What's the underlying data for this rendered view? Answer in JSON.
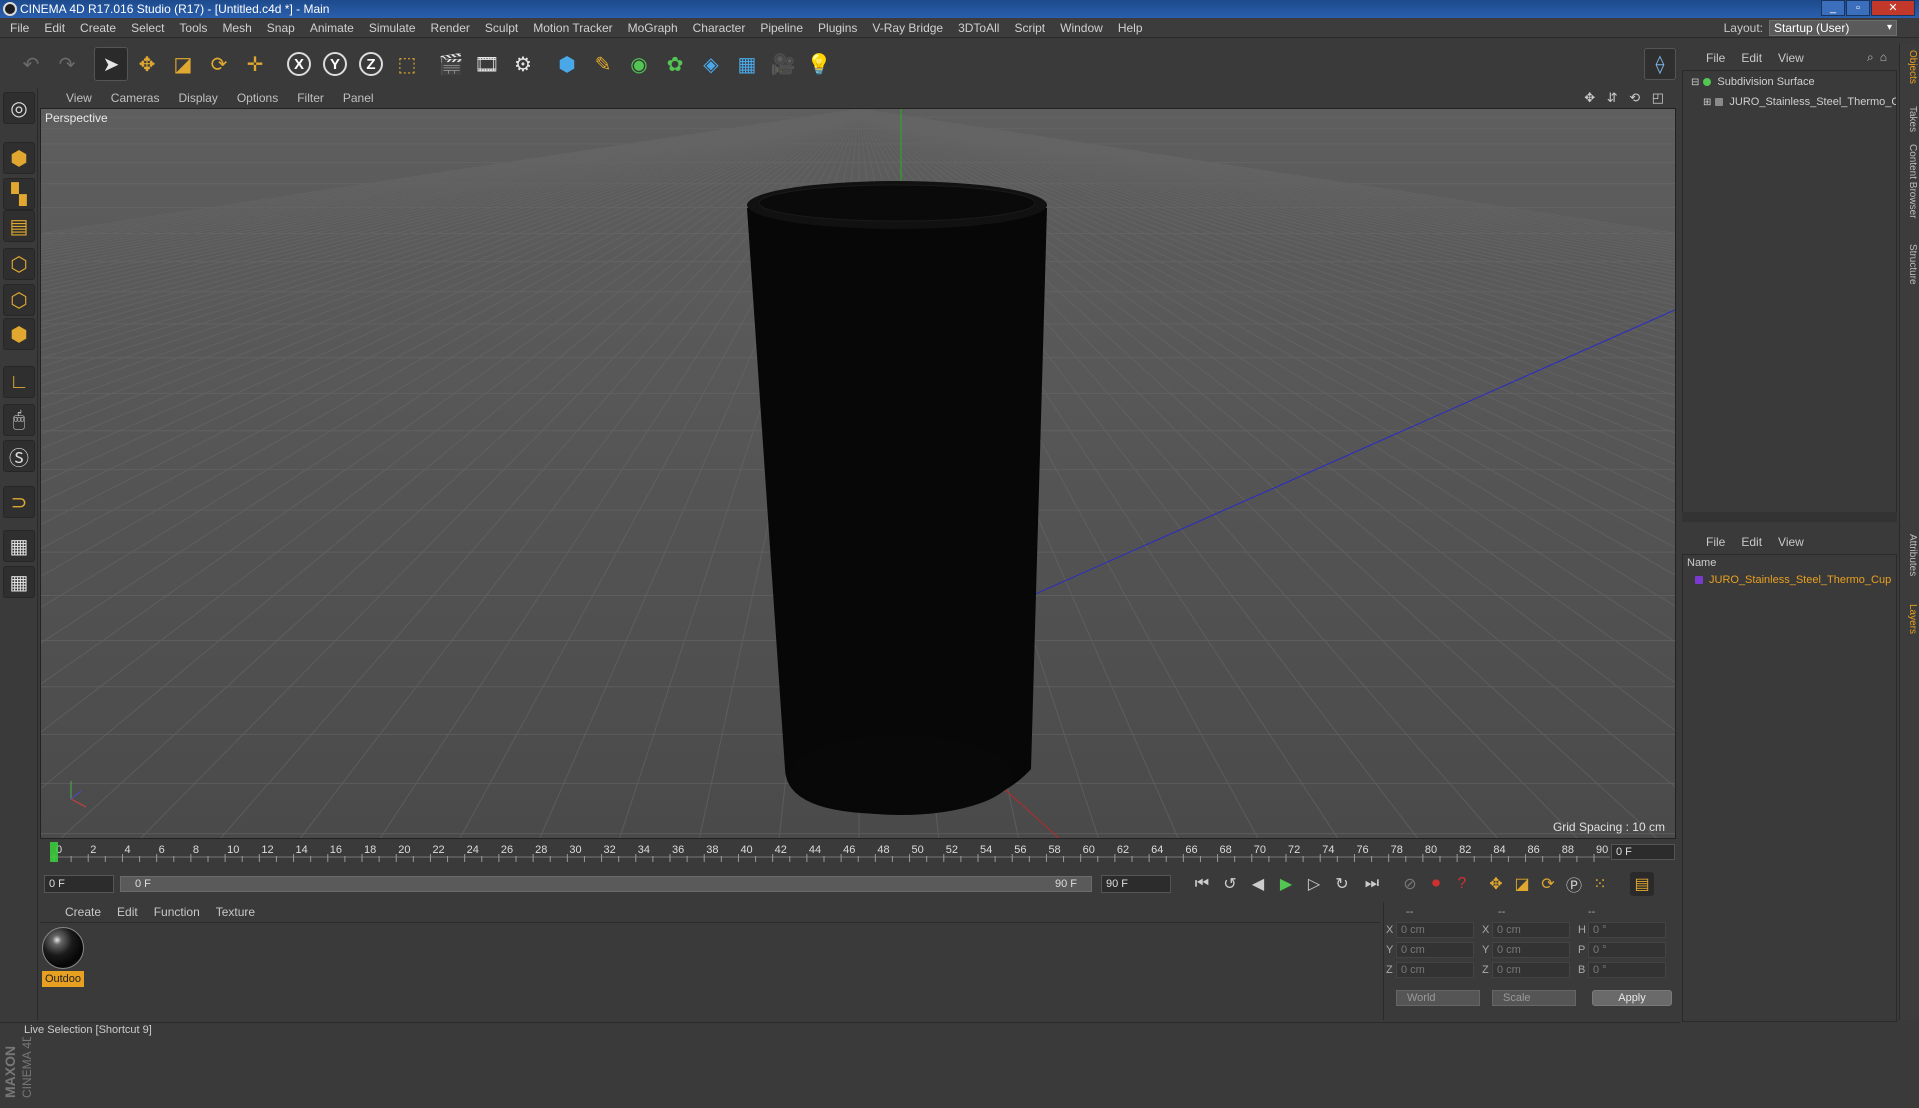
{
  "window": {
    "title": "CINEMA 4D R17.016 Studio (R17) - [Untitled.c4d *] - Main",
    "buttons": [
      "_",
      "▫",
      "✕"
    ]
  },
  "menubar": {
    "items": [
      "File",
      "Edit",
      "Create",
      "Select",
      "Tools",
      "Mesh",
      "Snap",
      "Animate",
      "Simulate",
      "Render",
      "Sculpt",
      "Motion Tracker",
      "MoGraph",
      "Character",
      "Pipeline",
      "Plugins",
      "V-Ray Bridge",
      "3DToAll",
      "Script",
      "Window",
      "Help"
    ],
    "layout_label": "Layout:",
    "layout_value": "Startup (User)"
  },
  "toolbar": {
    "icons": [
      "undo-icon",
      "redo-icon",
      "live-selection-icon",
      "move-icon",
      "scale-icon",
      "rotate-icon",
      "add-object-icon",
      "x-axis-icon",
      "y-axis-icon",
      "z-axis-icon",
      "world-coordinates-icon",
      "render-view-icon",
      "render-picture-viewer-icon",
      "edit-render-settings-icon",
      "cube-icon",
      "pen-icon",
      "subdivision-icon",
      "cloner-icon",
      "deformer-icon",
      "floor-icon",
      "camera-icon",
      "light-icon"
    ],
    "axis_labels": [
      "X",
      "Y",
      "Z"
    ]
  },
  "viewport": {
    "menu": [
      "View",
      "Cameras",
      "Display",
      "Options",
      "Filter",
      "Panel"
    ],
    "label": "Perspective",
    "grid_spacing": "Grid Spacing : 10 cm",
    "nav_icons": "✥ ⇵ ⟲ ◰"
  },
  "timeline": {
    "ticks": [
      "0",
      "2",
      "4",
      "6",
      "8",
      "10",
      "12",
      "14",
      "16",
      "18",
      "20",
      "22",
      "24",
      "26",
      "28",
      "30",
      "32",
      "34",
      "36",
      "38",
      "40",
      "42",
      "44",
      "46",
      "48",
      "50",
      "52",
      "54",
      "56",
      "58",
      "60",
      "62",
      "64",
      "66",
      "68",
      "70",
      "72",
      "74",
      "76",
      "78",
      "80",
      "82",
      "84",
      "86",
      "88",
      "90"
    ],
    "current_frame": "0 F",
    "start_field": "0 F",
    "range_start": "0 F",
    "range_end": "90 F",
    "end_field": "90 F"
  },
  "material_manager": {
    "menu": [
      "Create",
      "Edit",
      "Function",
      "Texture"
    ],
    "materials": [
      {
        "name": "Outdoo"
      }
    ]
  },
  "coordinates": {
    "headers": [
      "--",
      "--",
      "--"
    ],
    "rows": [
      {
        "a": "X",
        "av": "0 cm",
        "b": "X",
        "bv": "0 cm",
        "c": "H",
        "cv": "0 °"
      },
      {
        "a": "Y",
        "av": "0 cm",
        "b": "Y",
        "bv": "0 cm",
        "c": "P",
        "cv": "0 °"
      },
      {
        "a": "Z",
        "av": "0 cm",
        "b": "Z",
        "bv": "0 cm",
        "c": "B",
        "cv": "0 °"
      }
    ],
    "mode_select": "World",
    "size_select": "Scale",
    "apply_label": "Apply"
  },
  "status": "Live Selection [Shortcut 9]",
  "object_manager": {
    "menu": [
      "File",
      "Edit",
      "View"
    ],
    "objects": [
      {
        "name": "Subdivision Surface",
        "color": "#52c552"
      },
      {
        "name": "JURO_Stainless_Steel_Thermo_Cup",
        "color": "#8a8a8a"
      }
    ]
  },
  "layer_manager": {
    "menu": [
      "File",
      "Edit",
      "View"
    ],
    "column": "Name",
    "layers": [
      {
        "name": "JURO_Stainless_Steel_Thermo_Cup",
        "color": "#7a3ad0"
      }
    ]
  },
  "right_tabs": [
    "Objects",
    "Takes",
    "Content Browser",
    "Structure",
    "Attributes",
    "Layers"
  ],
  "logo_text": [
    "MAXON",
    "CINEMA 4D"
  ]
}
